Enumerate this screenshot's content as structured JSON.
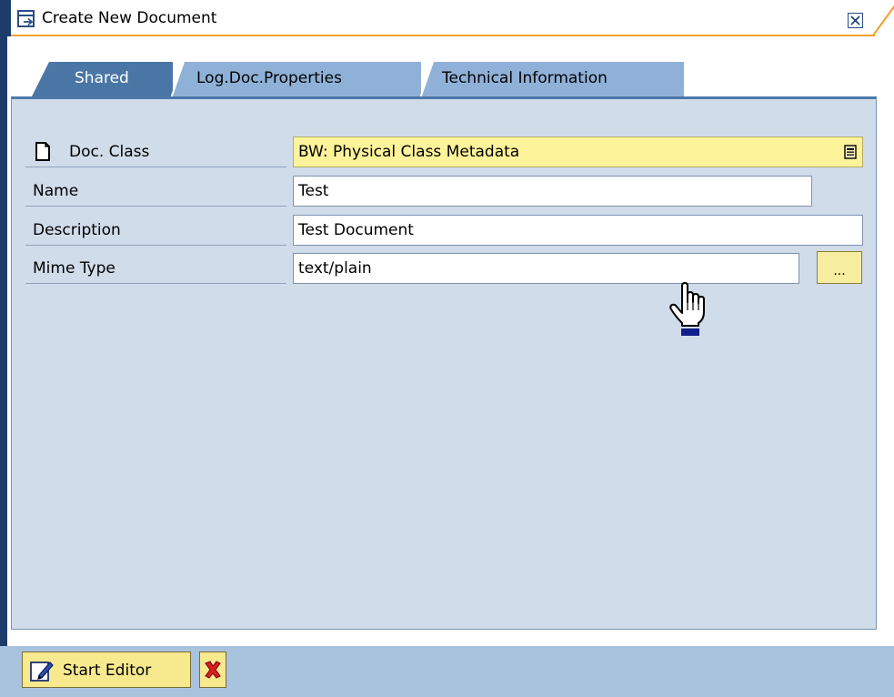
{
  "window": {
    "title": "Create New Document"
  },
  "tabs": [
    {
      "label": "Shared",
      "active": true
    },
    {
      "label": "Log.Doc.Properties",
      "active": false
    },
    {
      "label": "Technical Information",
      "active": false
    }
  ],
  "form": {
    "doc_class": {
      "label": "Doc. Class",
      "value": "BW: Physical Class Metadata"
    },
    "name": {
      "label": "Name",
      "value": "Test"
    },
    "description": {
      "label": "Description",
      "value": "Test Document"
    },
    "mime_type": {
      "label": "Mime Type",
      "value": "text/plain",
      "value_help_label": "..."
    }
  },
  "toolbar": {
    "start_editor_label": "Start Editor"
  },
  "icons": {
    "window": "window-icon",
    "close": "close-icon",
    "document": "document-icon",
    "dropdown": "dropdown-icon",
    "edit": "edit-pencil-icon",
    "cancel": "cancel-x-icon",
    "cursor": "hand-cursor-icon"
  },
  "colors": {
    "frame_dark": "#1c3d6b",
    "title_accent": "#f0a030",
    "panel_background": "#d1dcea",
    "tab_active": "#4a76a6",
    "tab_inactive": "#8fb1d8",
    "required_field": "#fdf39a",
    "button_yellow": "#f6e98e",
    "toolbar_background": "#a9c2de",
    "cancel_red": "#d81e1e"
  }
}
